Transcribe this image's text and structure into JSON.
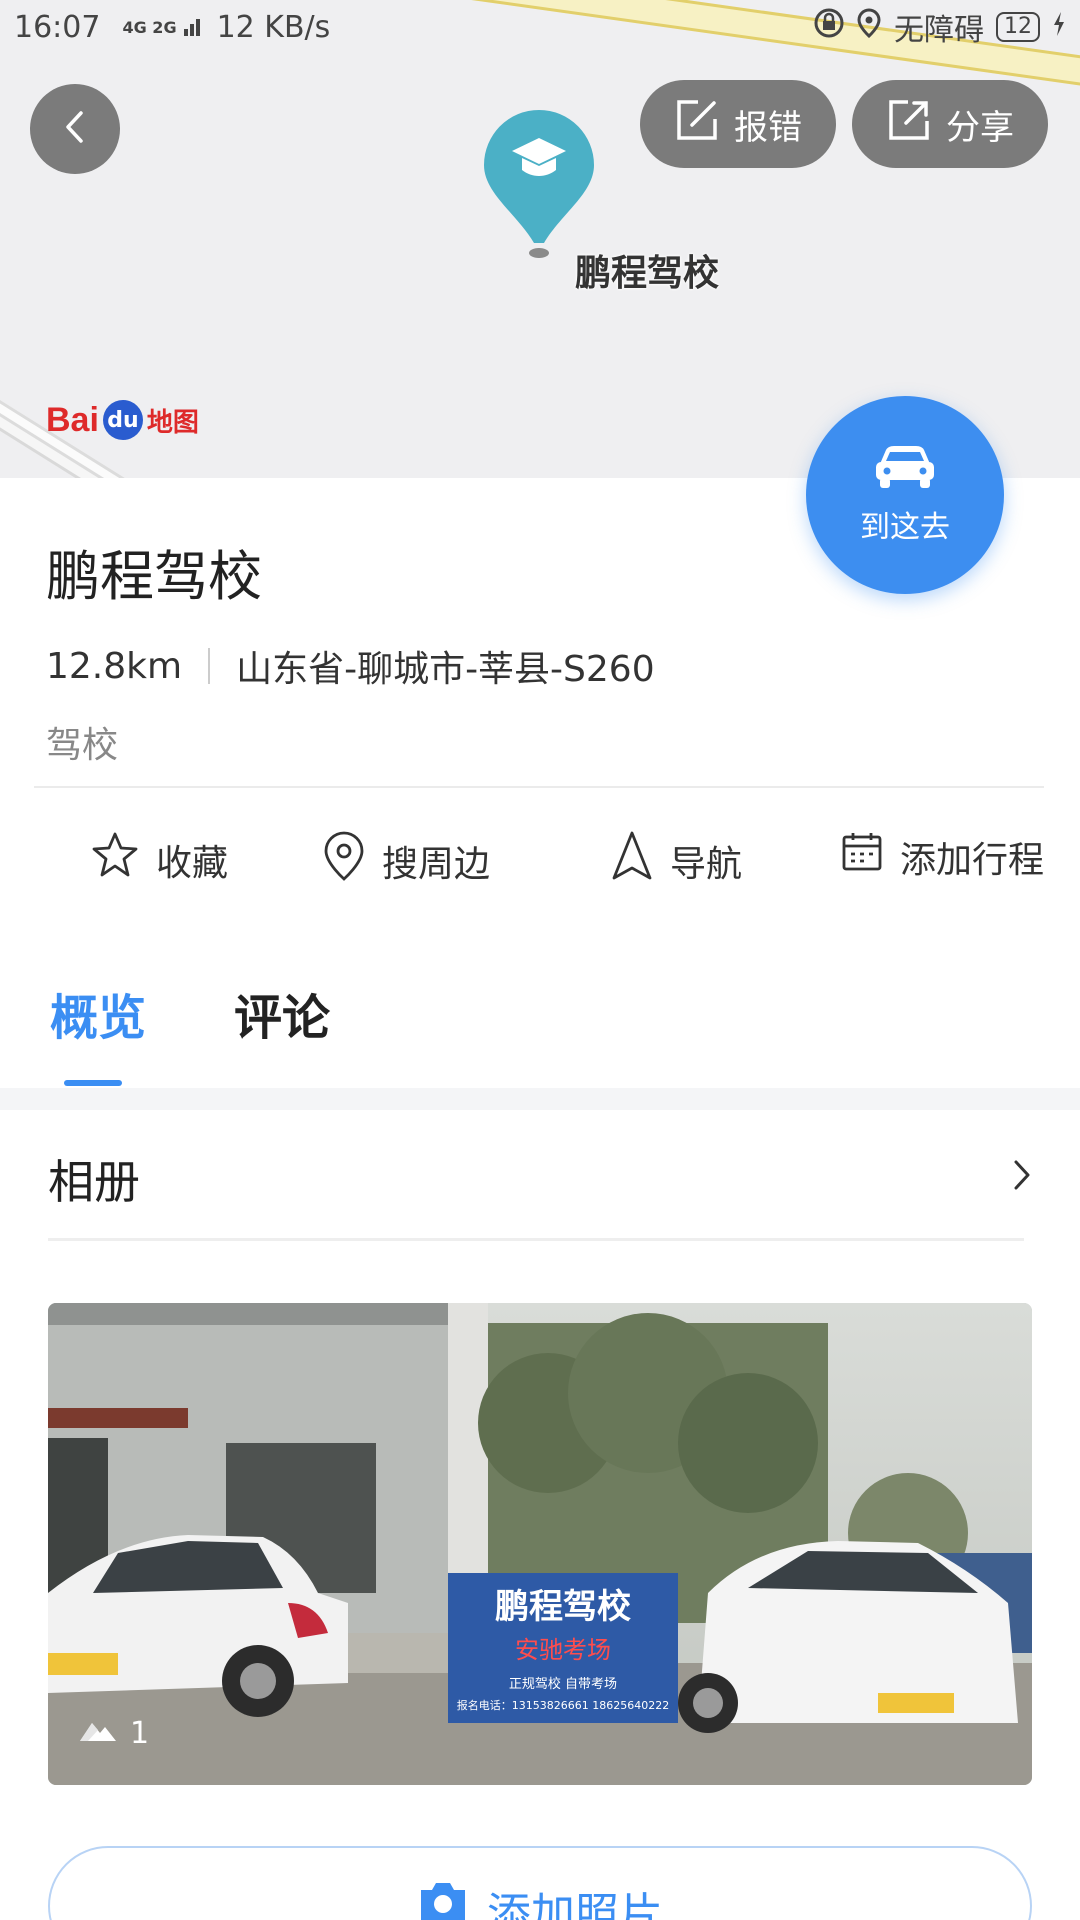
{
  "status_bar": {
    "time": "16:07",
    "network": "4G 2G",
    "speed": "12 KB/s",
    "accessibility": "无障碍",
    "battery": "12"
  },
  "map": {
    "pin_label": "鹏程驾校",
    "logo_text": "Baidu地图"
  },
  "header": {
    "report_label": "报错",
    "share_label": "分享"
  },
  "fab": {
    "label": "到这去"
  },
  "place": {
    "name": "鹏程驾校",
    "distance": "12.8km",
    "address": "山东省-聊城市-莘县-S260",
    "category": "驾校"
  },
  "actions": {
    "favorite": "收藏",
    "nearby": "搜周边",
    "navigate": "导航",
    "add_trip": "添加行程"
  },
  "tabs": {
    "overview": "概览",
    "reviews": "评论"
  },
  "album": {
    "title": "相册",
    "photo_count": "1",
    "add_photo_label": "添加照片"
  },
  "colors": {
    "accent": "#3b8ef3",
    "fab": "#3d8ef0",
    "pin": "#4bb0c6"
  }
}
